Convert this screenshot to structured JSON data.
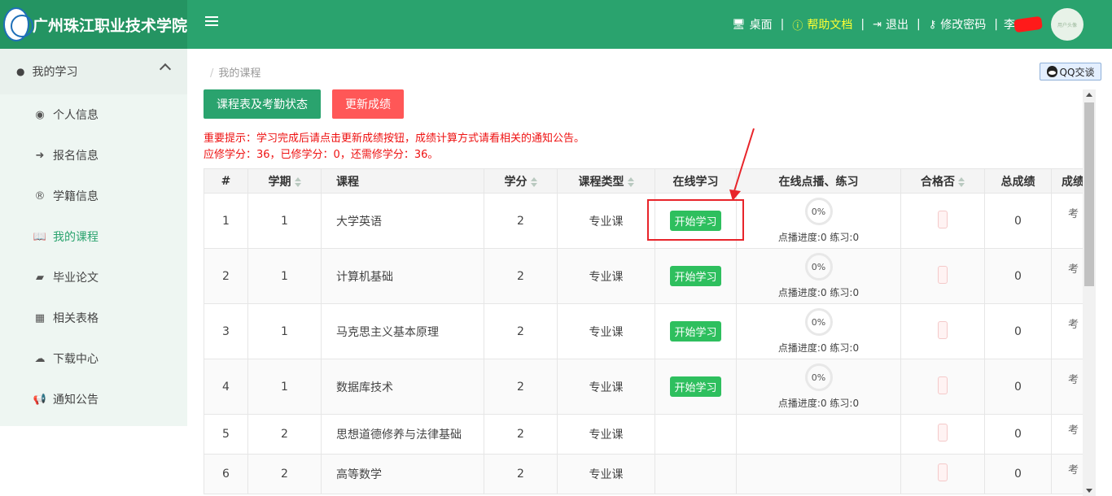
{
  "header": {
    "school_name": "广州珠江职业技术学院",
    "nav": [
      {
        "label": "桌面",
        "icon": "desktop-icon"
      },
      {
        "label": "帮助文档",
        "icon": "question-circle-icon"
      },
      {
        "label": "退出",
        "icon": "sign-out-icon"
      },
      {
        "label": "修改密码",
        "icon": "key-icon"
      }
    ],
    "separator": "|",
    "username": "李",
    "avatar_text": "用户头像",
    "brand_color": "#2aa36e",
    "help_color": "#ffff33"
  },
  "sidebar": {
    "section_label": "我的学习",
    "items": [
      {
        "label": "个人信息",
        "icon": "user-circle-icon"
      },
      {
        "label": "报名信息",
        "icon": "sign-in-icon"
      },
      {
        "label": "学籍信息",
        "icon": "registered-icon"
      },
      {
        "label": "我的课程",
        "icon": "book-open-icon",
        "active": true
      },
      {
        "label": "毕业论文",
        "icon": "book-icon"
      },
      {
        "label": "相关表格",
        "icon": "table-icon"
      },
      {
        "label": "下载中心",
        "icon": "cloud-download-icon"
      },
      {
        "label": "通知公告",
        "icon": "bullhorn-icon"
      }
    ]
  },
  "main": {
    "breadcrumb": "我的课程",
    "qq_label": "QQ交谈",
    "buttons": {
      "schedule": "课程表及考勤状态",
      "update_grades": "更新成绩"
    },
    "notice_line1": "重要提示：学习完成后请点击更新成绩按钮，成绩计算方式请看相关的通知公告。",
    "notice_line2": "应修学分：36，已修学分：0，还需修学分：36。"
  },
  "table": {
    "headers": [
      "#",
      "学期",
      "课程",
      "学分",
      "课程类型",
      "在线学习",
      "在线点播、练习",
      "合格否",
      "总成绩",
      "成绩"
    ],
    "rows": [
      {
        "no": "1",
        "term": "1",
        "course": "大学英语",
        "credit": "2",
        "type": "专业课",
        "online": "开始学习",
        "progress": "0%",
        "progress_text": "点播进度:0 练习:0",
        "total": "0",
        "extra": "考"
      },
      {
        "no": "2",
        "term": "1",
        "course": "计算机基础",
        "credit": "2",
        "type": "专业课",
        "online": "开始学习",
        "progress": "0%",
        "progress_text": "点播进度:0 练习:0",
        "total": "0",
        "extra": "考"
      },
      {
        "no": "3",
        "term": "1",
        "course": "马克思主义基本原理",
        "credit": "2",
        "type": "专业课",
        "online": "开始学习",
        "progress": "0%",
        "progress_text": "点播进度:0 练习:0",
        "total": "0",
        "extra": "考"
      },
      {
        "no": "4",
        "term": "1",
        "course": "数据库技术",
        "credit": "2",
        "type": "专业课",
        "online": "开始学习",
        "progress": "0%",
        "progress_text": "点播进度:0 练习:0",
        "total": "0",
        "extra": "考"
      },
      {
        "no": "5",
        "term": "2",
        "course": "思想道德修养与法律基础",
        "credit": "2",
        "type": "专业课",
        "online": "",
        "progress": "",
        "progress_text": "",
        "total": "0",
        "extra": "考"
      },
      {
        "no": "6",
        "term": "2",
        "course": "高等数学",
        "credit": "2",
        "type": "专业课",
        "online": "",
        "progress": "",
        "progress_text": "",
        "total": "0",
        "extra": "考"
      }
    ]
  }
}
